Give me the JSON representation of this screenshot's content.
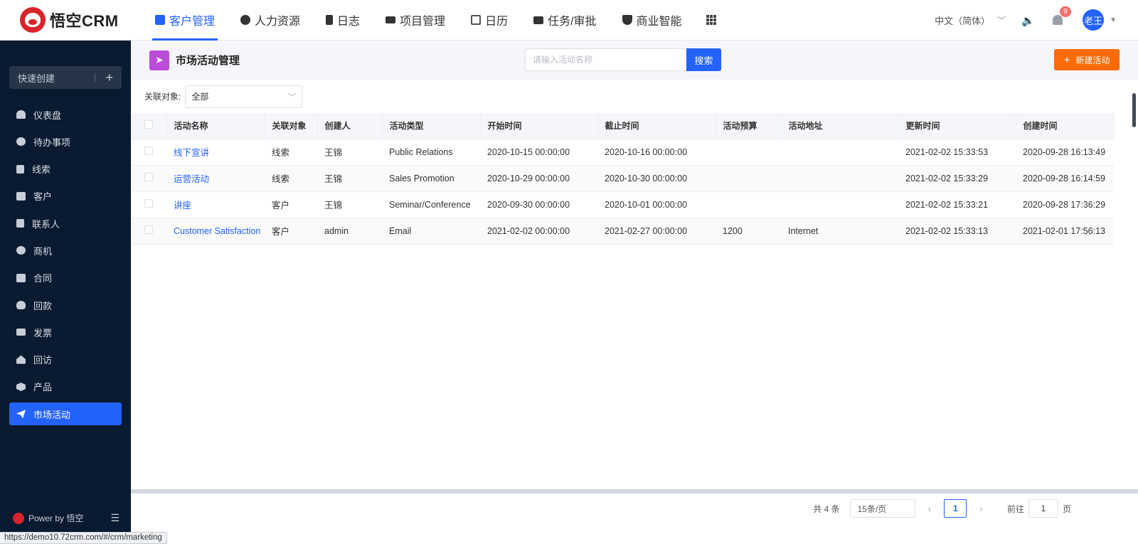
{
  "app": {
    "logo_text": "悟空CRM"
  },
  "nav": {
    "items": [
      {
        "label": "客户管理",
        "icon": "customer-icon",
        "active": true
      },
      {
        "label": "人力资源",
        "icon": "people-icon"
      },
      {
        "label": "日志",
        "icon": "log-icon"
      },
      {
        "label": "项目管理",
        "icon": "project-icon"
      },
      {
        "label": "日历",
        "icon": "calendar-icon"
      },
      {
        "label": "任务/审批",
        "icon": "briefcase-icon"
      },
      {
        "label": "商业智能",
        "icon": "shield-icon"
      }
    ],
    "language": "中文（简体）",
    "notification_count": "9",
    "user": "老王"
  },
  "sidebar": {
    "quick_create": "快速创建",
    "items": [
      {
        "label": "仪表盘",
        "icon": "dashboard-icon"
      },
      {
        "label": "待办事项",
        "icon": "chat-icon"
      },
      {
        "label": "线索",
        "icon": "lead-icon"
      },
      {
        "label": "客户",
        "icon": "customer-icon"
      },
      {
        "label": "联系人",
        "icon": "contact-icon"
      },
      {
        "label": "商机",
        "icon": "dollar-icon"
      },
      {
        "label": "合同",
        "icon": "contract-icon"
      },
      {
        "label": "回款",
        "icon": "money-bag-icon"
      },
      {
        "label": "发票",
        "icon": "invoice-icon"
      },
      {
        "label": "回访",
        "icon": "home-icon"
      },
      {
        "label": "产品",
        "icon": "box-icon"
      },
      {
        "label": "市场活动",
        "icon": "send-icon",
        "active": true
      }
    ],
    "footer": "Power by 悟空"
  },
  "page": {
    "title": "市场活动管理",
    "search_placeholder": "请输入活动名称",
    "search_button": "搜索",
    "new_button": "新建活动",
    "filter_label": "关联对象:",
    "filter_value": "全部"
  },
  "table": {
    "columns": [
      "活动名称",
      "关联对象",
      "创建人",
      "活动类型",
      "开始时间",
      "截止时间",
      "活动预算",
      "活动地址",
      "更新时间",
      "创建时间"
    ],
    "rows": [
      [
        "线下宣讲",
        "线索",
        "王锦",
        "Public Relations",
        "2020-10-15 00:00:00",
        "2020-10-16 00:00:00",
        "",
        "",
        "2021-02-02 15:33:53",
        "2020-09-28 16:13:49"
      ],
      [
        "运营活动",
        "线索",
        "王锦",
        "Sales Promotion",
        "2020-10-29 00:00:00",
        "2020-10-30 00:00:00",
        "",
        "",
        "2021-02-02 15:33:29",
        "2020-09-28 16:14:59"
      ],
      [
        "讲座",
        "客户",
        "王锦",
        "Seminar/Conference",
        "2020-09-30 00:00:00",
        "2020-10-01 00:00:00",
        "",
        "",
        "2021-02-02 15:33:21",
        "2020-09-28 17:36:29"
      ],
      [
        "Customer Satisfaction",
        "客户",
        "admin",
        "Email",
        "2021-02-02 00:00:00",
        "2021-02-27 00:00:00",
        "1200",
        "Internet",
        "2021-02-02 15:33:13",
        "2021-02-01 17:56:13"
      ]
    ]
  },
  "pager": {
    "total": "共 4 条",
    "page_size": "15条/页",
    "current_page": "1",
    "goto_label": "前往",
    "goto_value": "1",
    "goto_suffix": "页"
  },
  "statusbar": {
    "url": "https://demo10.72crm.com/#/crm/marketing"
  }
}
